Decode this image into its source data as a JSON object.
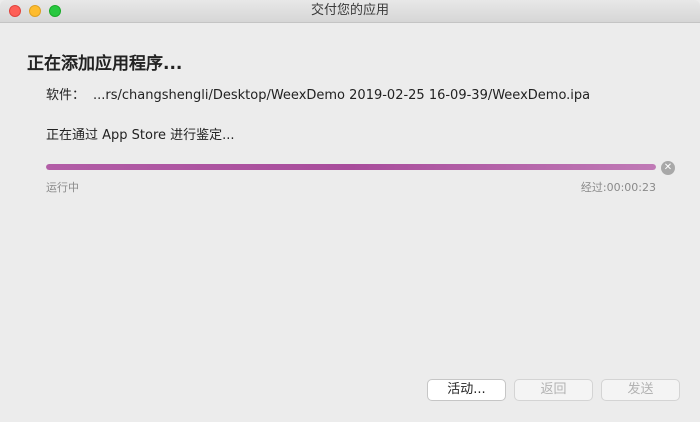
{
  "window": {
    "title": "交付您的应用"
  },
  "main": {
    "heading": "正在添加应用程序...",
    "software_label": "软件：",
    "software_path": "...rs/changshengli/Desktop/WeexDemo 2019-02-25 16-09-39/WeexDemo.ipa",
    "status": "正在通过 App Store 进行鉴定...",
    "progress_fraction": 1.0,
    "progress_state": "运行中",
    "elapsed": "经过:00:00:23"
  },
  "buttons": {
    "activity": "活动...",
    "back": "返回",
    "send": "发送"
  },
  "icons": {
    "stop": "close-circle-icon"
  },
  "colors": {
    "progress": "#a84c9b",
    "close": "#fe5f57",
    "minimize": "#febc2e",
    "zoom": "#28c840"
  }
}
